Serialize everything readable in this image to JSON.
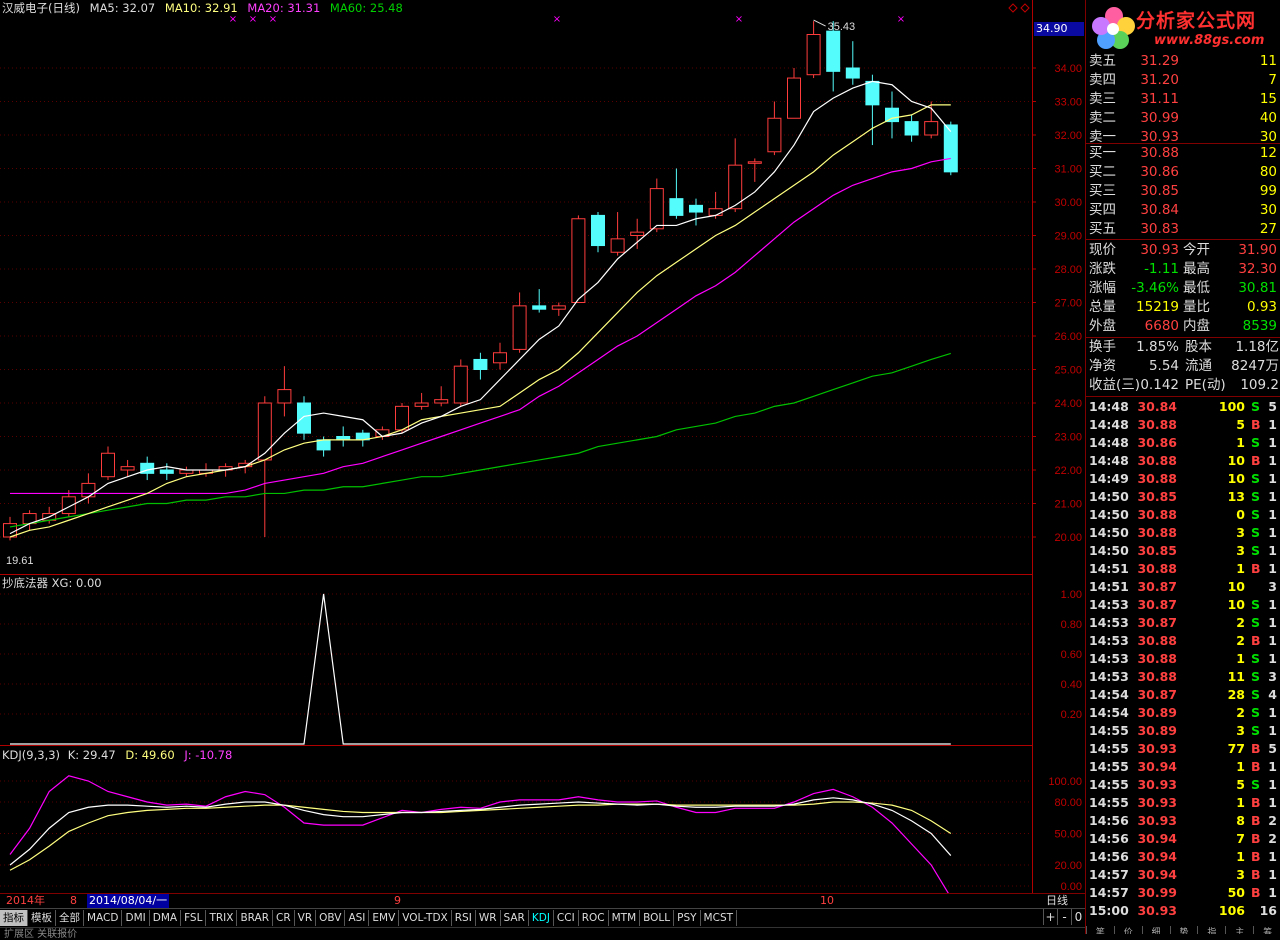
{
  "header": {
    "stock": "汉威电子(日线)",
    "ma5": "MA5: 32.07",
    "ma10": "MA10: 32.91",
    "ma20": "MA20: 31.31",
    "ma60": "MA60: 25.48",
    "price_tag": "34.90",
    "high_label": "35.43",
    "low_label": "19.61"
  },
  "colors": {
    "up": "#ff3c3c",
    "down": "#54fcfc",
    "ma5": "#ffffff",
    "ma10": "#ffff80",
    "ma20": "#ff00ff",
    "ma60": "#00c000",
    "axis": "#b00000"
  },
  "price_axis": [
    "34.00",
    "33.00",
    "32.00",
    "31.00",
    "30.00",
    "29.00",
    "28.00",
    "27.00",
    "26.00",
    "25.00",
    "24.00",
    "23.00",
    "22.00",
    "21.00",
    "20.00"
  ],
  "ind1": {
    "title": "抄底法器 XG: 0.00",
    "axis": [
      "1.00",
      "0.80",
      "0.60",
      "0.40",
      "0.20"
    ]
  },
  "kdj": {
    "label": "KDJ(9,3,3)",
    "k": "K: 29.47",
    "d": "D: 49.60",
    "j": "J: -10.78",
    "axis": [
      "100.00",
      "80.00",
      "50.00",
      "20.00",
      "0.00"
    ]
  },
  "scale": {
    "year": "2014年",
    "m8": "8",
    "date": "2014/08/04/一",
    "m9": "9",
    "m10": "10",
    "period": "日线"
  },
  "tabs": [
    "指标",
    "模板",
    "全部",
    "MACD",
    "DMI",
    "DMA",
    "FSL",
    "TRIX",
    "BRAR",
    "CR",
    "VR",
    "OBV",
    "ASI",
    "EMV",
    "VOL-TDX",
    "RSI",
    "WR",
    "SAR",
    "KDJ",
    "CCI",
    "ROC",
    "MTM",
    "BOLL",
    "PSY",
    "MCST"
  ],
  "tab_controls": [
    "+",
    "-",
    "0"
  ],
  "under_text": "扩展区  关联报价",
  "logo": {
    "text": "分析家公式网",
    "url": "www.88gs.com"
  },
  "quotes": {
    "sell": [
      {
        "label": "卖五",
        "price": "31.29",
        "vol": "11"
      },
      {
        "label": "卖四",
        "price": "31.20",
        "vol": "7"
      },
      {
        "label": "卖三",
        "price": "31.11",
        "vol": "15"
      },
      {
        "label": "卖二",
        "price": "30.99",
        "vol": "40"
      },
      {
        "label": "卖一",
        "price": "30.93",
        "vol": "30"
      }
    ],
    "buy": [
      {
        "label": "买一",
        "price": "30.88",
        "vol": "12"
      },
      {
        "label": "买二",
        "price": "30.86",
        "vol": "80"
      },
      {
        "label": "买三",
        "price": "30.85",
        "vol": "99"
      },
      {
        "label": "买四",
        "price": "30.84",
        "vol": "30"
      },
      {
        "label": "买五",
        "price": "30.83",
        "vol": "27"
      }
    ]
  },
  "stats": [
    {
      "l1": "现价",
      "v1": "30.93",
      "l2": "今开",
      "v2": "31.90"
    },
    {
      "l1": "涨跌",
      "v1": "-1.11",
      "l2": "最高",
      "v2": "32.30"
    },
    {
      "l1": "涨幅",
      "v1": "-3.46%",
      "l2": "最低",
      "v2": "30.81"
    },
    {
      "l1": "总量",
      "v1": "15219",
      "l2": "量比",
      "v2": "0.93"
    },
    {
      "l1": "外盘",
      "v1": "6680",
      "l2": "内盘",
      "v2": "8539"
    }
  ],
  "stats2": [
    {
      "l1": "换手",
      "v1": "1.85%",
      "l2": "股本",
      "v2": "1.18亿"
    },
    {
      "l1": "净资",
      "v1": "5.54",
      "l2": "流通",
      "v2": "8247万"
    },
    {
      "l1": "收益(三)",
      "v1": "0.142",
      "l2": "PE(动)",
      "v2": "109.2"
    }
  ],
  "ticks": [
    {
      "t": "14:48",
      "p": "30.84",
      "v": "100",
      "s": "S",
      "n": "5"
    },
    {
      "t": "14:48",
      "p": "30.88",
      "v": "5",
      "s": "B",
      "n": "1"
    },
    {
      "t": "14:48",
      "p": "30.86",
      "v": "1",
      "s": "S",
      "n": "1"
    },
    {
      "t": "14:48",
      "p": "30.88",
      "v": "10",
      "s": "B",
      "n": "1"
    },
    {
      "t": "14:49",
      "p": "30.88",
      "v": "10",
      "s": "S",
      "n": "1"
    },
    {
      "t": "14:50",
      "p": "30.85",
      "v": "13",
      "s": "S",
      "n": "1"
    },
    {
      "t": "14:50",
      "p": "30.88",
      "v": "0",
      "s": "S",
      "n": "1"
    },
    {
      "t": "14:50",
      "p": "30.88",
      "v": "3",
      "s": "S",
      "n": "1"
    },
    {
      "t": "14:50",
      "p": "30.85",
      "v": "3",
      "s": "S",
      "n": "1"
    },
    {
      "t": "14:51",
      "p": "30.88",
      "v": "1",
      "s": "B",
      "n": "1"
    },
    {
      "t": "14:51",
      "p": "30.87",
      "v": "10",
      "s": "",
      "n": "3"
    },
    {
      "t": "14:53",
      "p": "30.87",
      "v": "10",
      "s": "S",
      "n": "1"
    },
    {
      "t": "14:53",
      "p": "30.87",
      "v": "2",
      "s": "S",
      "n": "1"
    },
    {
      "t": "14:53",
      "p": "30.88",
      "v": "2",
      "s": "B",
      "n": "1"
    },
    {
      "t": "14:53",
      "p": "30.88",
      "v": "1",
      "s": "S",
      "n": "1"
    },
    {
      "t": "14:53",
      "p": "30.88",
      "v": "11",
      "s": "S",
      "n": "3"
    },
    {
      "t": "14:54",
      "p": "30.87",
      "v": "28",
      "s": "S",
      "n": "4"
    },
    {
      "t": "14:54",
      "p": "30.89",
      "v": "2",
      "s": "S",
      "n": "1"
    },
    {
      "t": "14:55",
      "p": "30.89",
      "v": "3",
      "s": "S",
      "n": "1"
    },
    {
      "t": "14:55",
      "p": "30.93",
      "v": "77",
      "s": "B",
      "n": "5"
    },
    {
      "t": "14:55",
      "p": "30.94",
      "v": "1",
      "s": "B",
      "n": "1"
    },
    {
      "t": "14:55",
      "p": "30.93",
      "v": "5",
      "s": "S",
      "n": "1"
    },
    {
      "t": "14:55",
      "p": "30.93",
      "v": "1",
      "s": "B",
      "n": "1"
    },
    {
      "t": "14:56",
      "p": "30.93",
      "v": "8",
      "s": "B",
      "n": "2"
    },
    {
      "t": "14:56",
      "p": "30.94",
      "v": "7",
      "s": "B",
      "n": "2"
    },
    {
      "t": "14:56",
      "p": "30.94",
      "v": "1",
      "s": "B",
      "n": "1"
    },
    {
      "t": "14:57",
      "p": "30.94",
      "v": "3",
      "s": "B",
      "n": "1"
    },
    {
      "t": "14:57",
      "p": "30.99",
      "v": "50",
      "s": "B",
      "n": "1"
    },
    {
      "t": "15:00",
      "p": "30.93",
      "v": "106",
      "s": "",
      "n": "16"
    }
  ],
  "bottom_tabs": [
    "笔",
    "价",
    "细",
    "势",
    "指",
    "主",
    "筹"
  ],
  "chart_data": {
    "type": "candlestick",
    "ylim": [
      19.61,
      35.43
    ],
    "candles": [
      [
        20.0,
        20.4,
        20.6,
        19.9
      ],
      [
        20.4,
        20.7,
        20.8,
        20.2
      ],
      [
        20.5,
        20.7,
        20.9,
        20.4
      ],
      [
        20.7,
        21.2,
        21.4,
        20.6
      ],
      [
        21.2,
        21.6,
        21.9,
        21.0
      ],
      [
        21.8,
        22.5,
        22.7,
        21.7
      ],
      [
        22.0,
        22.1,
        22.3,
        21.8
      ],
      [
        22.2,
        21.9,
        22.4,
        21.7
      ],
      [
        22.0,
        21.9,
        22.2,
        21.7
      ],
      [
        21.9,
        22.0,
        22.1,
        21.8
      ],
      [
        21.9,
        22.0,
        22.2,
        21.8
      ],
      [
        22.0,
        22.1,
        22.2,
        21.8
      ],
      [
        22.1,
        22.2,
        22.3,
        21.9
      ],
      [
        22.3,
        24.0,
        24.2,
        20.0
      ],
      [
        24.0,
        24.4,
        25.1,
        23.6
      ],
      [
        24.0,
        23.1,
        24.2,
        22.9
      ],
      [
        22.9,
        22.6,
        23.0,
        22.4
      ],
      [
        23.0,
        22.9,
        23.3,
        22.7
      ],
      [
        23.1,
        22.9,
        23.2,
        22.7
      ],
      [
        23.0,
        23.2,
        23.3,
        22.9
      ],
      [
        23.2,
        23.9,
        24.0,
        23.1
      ],
      [
        23.9,
        24.0,
        24.3,
        23.8
      ],
      [
        24.0,
        24.1,
        24.5,
        23.9
      ],
      [
        24.0,
        25.1,
        25.3,
        23.9
      ],
      [
        25.3,
        25.0,
        25.5,
        24.7
      ],
      [
        25.2,
        25.5,
        25.8,
        25.0
      ],
      [
        25.6,
        26.9,
        27.3,
        25.5
      ],
      [
        26.9,
        26.8,
        27.4,
        26.7
      ],
      [
        26.8,
        26.9,
        27.0,
        26.6
      ],
      [
        27.0,
        29.5,
        29.6,
        27.0
      ],
      [
        29.6,
        28.7,
        29.7,
        28.5
      ],
      [
        28.5,
        28.9,
        29.7,
        28.4
      ],
      [
        29.0,
        29.1,
        29.5,
        28.6
      ],
      [
        29.2,
        30.4,
        30.7,
        29.1
      ],
      [
        30.1,
        29.6,
        31.0,
        29.5
      ],
      [
        29.9,
        29.7,
        30.1,
        29.3
      ],
      [
        29.6,
        29.8,
        30.3,
        29.5
      ],
      [
        29.8,
        31.1,
        31.9,
        29.7
      ],
      [
        31.2,
        31.2,
        31.3,
        30.6
      ],
      [
        31.5,
        32.5,
        33.0,
        31.4
      ],
      [
        32.5,
        33.7,
        34.0,
        32.5
      ],
      [
        33.8,
        35.0,
        35.4,
        33.7
      ],
      [
        35.1,
        33.9,
        35.4,
        33.3
      ],
      [
        34.0,
        33.7,
        34.8,
        33.5
      ],
      [
        33.6,
        32.9,
        33.8,
        31.7
      ],
      [
        32.8,
        32.4,
        33.3,
        31.9
      ],
      [
        32.4,
        32.0,
        32.6,
        31.8
      ],
      [
        32.0,
        32.4,
        33.0,
        31.9
      ],
      [
        32.3,
        30.9,
        32.4,
        30.8
      ]
    ],
    "ma5": [
      20.1,
      20.4,
      20.6,
      20.9,
      21.2,
      21.6,
      21.8,
      22.0,
      22.1,
      22.0,
      22.0,
      22.0,
      22.1,
      22.5,
      23.1,
      23.6,
      23.7,
      23.6,
      23.5,
      23.0,
      23.1,
      23.4,
      23.6,
      23.9,
      24.1,
      24.7,
      25.3,
      25.9,
      26.3,
      27.1,
      27.6,
      28.3,
      28.8,
      29.3,
      29.3,
      29.5,
      29.6,
      29.9,
      30.3,
      30.9,
      31.7,
      32.7,
      33.1,
      33.4,
      33.6,
      33.5,
      33.0,
      32.8,
      32.1
    ],
    "ma10": [
      20.0,
      20.2,
      20.3,
      20.5,
      20.7,
      20.9,
      21.1,
      21.3,
      21.6,
      21.8,
      21.9,
      22.0,
      22.1,
      22.3,
      22.6,
      22.8,
      22.9,
      22.9,
      22.9,
      23.0,
      23.2,
      23.5,
      23.6,
      23.7,
      23.8,
      23.9,
      24.3,
      24.7,
      25.0,
      25.5,
      26.1,
      26.7,
      27.3,
      27.8,
      28.2,
      28.6,
      29.0,
      29.3,
      29.7,
      30.1,
      30.5,
      30.9,
      31.4,
      31.8,
      32.2,
      32.5,
      32.6,
      32.9,
      32.9
    ],
    "ma20": [
      21.3,
      21.3,
      21.3,
      21.3,
      21.3,
      21.3,
      21.3,
      21.3,
      21.3,
      21.3,
      21.3,
      21.3,
      21.4,
      21.6,
      21.7,
      21.8,
      21.9,
      22.1,
      22.2,
      22.4,
      22.6,
      22.8,
      23.0,
      23.2,
      23.4,
      23.6,
      23.8,
      24.2,
      24.5,
      24.9,
      25.3,
      25.7,
      26.0,
      26.4,
      26.8,
      27.2,
      27.5,
      27.9,
      28.4,
      28.9,
      29.4,
      29.8,
      30.2,
      30.5,
      30.7,
      30.9,
      31.0,
      31.2,
      31.3
    ],
    "ma60": [
      20.3,
      20.4,
      20.5,
      20.6,
      20.7,
      20.8,
      20.9,
      21.0,
      21.0,
      21.1,
      21.1,
      21.2,
      21.2,
      21.3,
      21.3,
      21.4,
      21.4,
      21.5,
      21.5,
      21.6,
      21.7,
      21.8,
      21.8,
      21.9,
      22.0,
      22.1,
      22.2,
      22.3,
      22.4,
      22.5,
      22.7,
      22.8,
      22.9,
      23.0,
      23.2,
      23.3,
      23.4,
      23.6,
      23.7,
      23.9,
      24.0,
      24.2,
      24.4,
      24.6,
      24.8,
      24.9,
      25.1,
      25.3,
      25.48
    ],
    "xg": [
      0,
      0,
      0,
      0,
      0,
      0,
      0,
      0,
      0,
      0,
      0,
      0,
      0,
      0,
      0,
      0,
      1,
      0,
      0,
      0,
      0,
      0,
      0,
      0,
      0,
      0,
      0,
      0,
      0,
      0,
      0,
      0,
      0,
      0,
      0,
      0,
      0,
      0,
      0,
      0,
      0,
      0,
      0,
      0,
      0,
      0,
      0,
      0,
      0
    ],
    "kdj_k": [
      20,
      35,
      55,
      70,
      75,
      77,
      77,
      76,
      75,
      76,
      75,
      78,
      80,
      80,
      77,
      72,
      68,
      66,
      66,
      68,
      70,
      70,
      71,
      72,
      73,
      75,
      77,
      78,
      79,
      80,
      79,
      78,
      77,
      78,
      76,
      75,
      75,
      76,
      76,
      76,
      78,
      82,
      84,
      82,
      78,
      72,
      62,
      50,
      29
    ],
    "kdj_d": [
      15,
      25,
      38,
      52,
      60,
      67,
      70,
      72,
      73,
      74,
      74,
      75,
      76,
      77,
      77,
      75,
      73,
      71,
      70,
      70,
      70,
      70,
      70,
      71,
      72,
      73,
      74,
      75,
      76,
      77,
      77,
      78,
      78,
      78,
      77,
      77,
      77,
      77,
      77,
      77,
      77,
      78,
      80,
      80,
      79,
      77,
      72,
      62,
      50
    ],
    "kdj_j": [
      30,
      55,
      90,
      105,
      100,
      90,
      85,
      80,
      77,
      78,
      76,
      85,
      90,
      87,
      75,
      60,
      58,
      58,
      58,
      65,
      72,
      70,
      73,
      75,
      74,
      80,
      82,
      82,
      82,
      85,
      82,
      80,
      80,
      81,
      75,
      70,
      70,
      74,
      74,
      74,
      80,
      88,
      92,
      85,
      75,
      60,
      40,
      20,
      -10.78
    ]
  }
}
